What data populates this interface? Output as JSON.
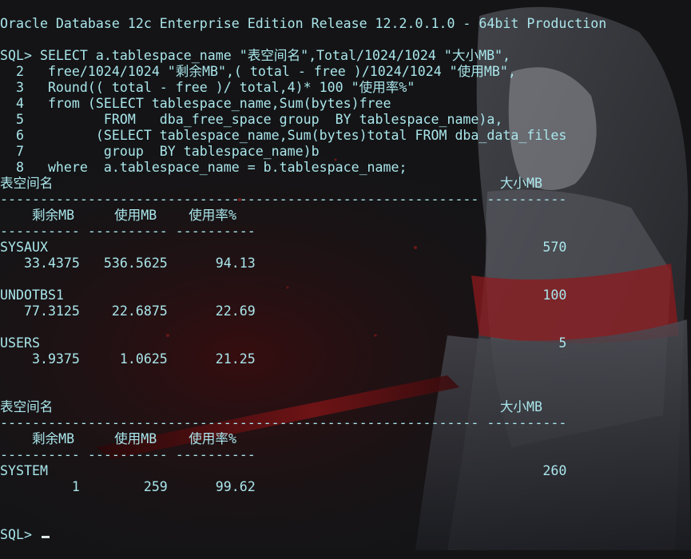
{
  "terminal": {
    "banner": "Oracle Database 12c Enterprise Edition Release 12.2.0.1.0 - 64bit Production",
    "query_lines": [
      "SQL> SELECT a.tablespace_name \"表空间名\",Total/1024/1024 \"大小MB\",",
      "  2   free/1024/1024 \"剩余MB\",( total - free )/1024/1024 \"使用MB\",",
      "  3   Round(( total - free )/ total,4)* 100 \"使用率%\"",
      "  4   from (SELECT tablespace_name,Sum(bytes)free",
      "  5          FROM   dba_free_space group  BY tablespace_name)a,",
      "  6         (SELECT tablespace_name,Sum(bytes)total FROM dba_data_files",
      "  7          group  BY tablespace_name)b",
      "  8   where  a.tablespace_name = b.tablespace_name;"
    ],
    "result_lines": [
      "表空间名                                                        大小MB",
      "------------------------------------------------------------ ----------",
      "    剩余MB     使用MB    使用率%",
      "---------- ---------- ----------",
      "SYSAUX                                                              570",
      "   33.4375   536.5625      94.13",
      "",
      "UNDOTBS1                                                            100",
      "   77.3125    22.6875      22.69",
      "",
      "USERS                                                                 5",
      "    3.9375     1.0625      21.25",
      "",
      "",
      "表空间名                                                        大小MB",
      "------------------------------------------------------------ ----------",
      "    剩余MB     使用MB    使用率%",
      "---------- ---------- ----------",
      "SYSTEM                                                              260",
      "         1        259      99.62",
      "",
      ""
    ],
    "prompt": "SQL> "
  },
  "colors": {
    "text": "#a9e6eb",
    "background": "#141416",
    "accent_red": "#8e1a1e"
  }
}
